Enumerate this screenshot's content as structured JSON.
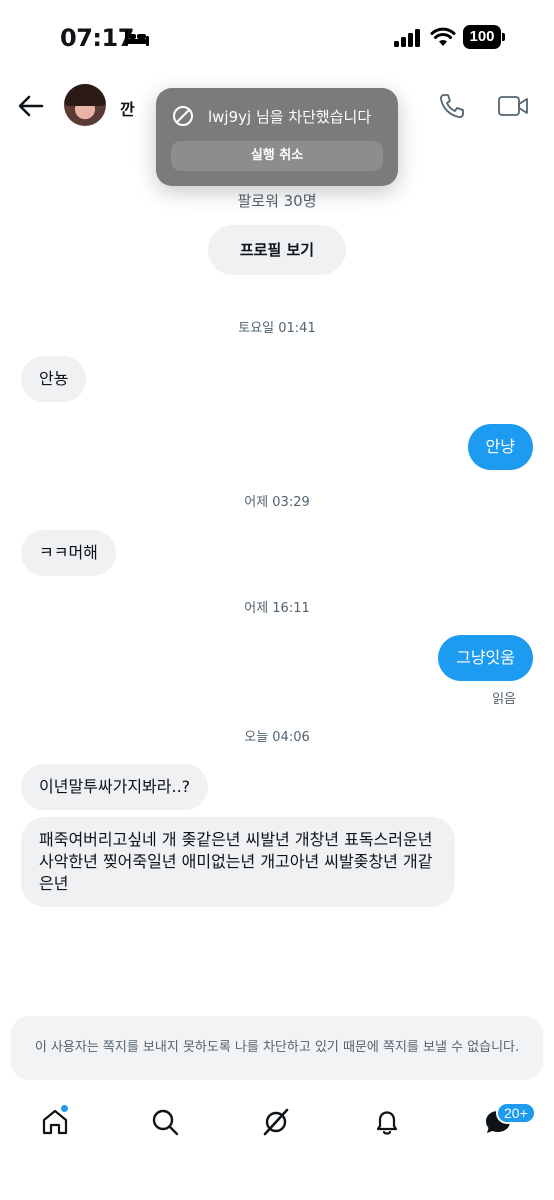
{
  "status_bar": {
    "time": "07:17",
    "battery": "100"
  },
  "header": {
    "contact_name": "깐"
  },
  "toast": {
    "message": "lwj9yj 님을 차단했습니다",
    "undo_label": "실행 취소"
  },
  "profile": {
    "followers": "팔로워 30명",
    "view_profile_label": "프로필 보기"
  },
  "conversation": {
    "timestamps": [
      "토요일 01:41",
      "어제 03:29",
      "어제 16:11",
      "오늘 04:06"
    ],
    "messages": [
      {
        "direction": "in",
        "text": "안뇽"
      },
      {
        "direction": "out",
        "text": "안냥"
      },
      {
        "direction": "in",
        "text": "ㅋㅋ머해"
      },
      {
        "direction": "out",
        "text": "그냥잇움"
      },
      {
        "direction": "in",
        "text": "이년말투싸가지봐라..?"
      },
      {
        "direction": "in",
        "text": "패죽여버리고싶네 개 좆같은년 씨발년 개창년 표독스러운년 사악한년 찢어죽일년 애미없는년 개고아년 씨발좆창년 개같은년"
      }
    ],
    "read_receipt": "읽음"
  },
  "blocked_notice": "이 사용자는 쪽지를 보내지 못하도록 나를 차단하고 있기 때문에 쪽지를 보낼 수 없습니다.",
  "bottom_nav": {
    "items": [
      "home-icon",
      "search-icon",
      "grok-icon",
      "bell-icon",
      "messages-icon"
    ],
    "messages_badge": "20+"
  },
  "colors": {
    "accent": "#1d9bf0",
    "bubble_in": "#eff1f3",
    "toast_bg": "#7b7b7b"
  }
}
